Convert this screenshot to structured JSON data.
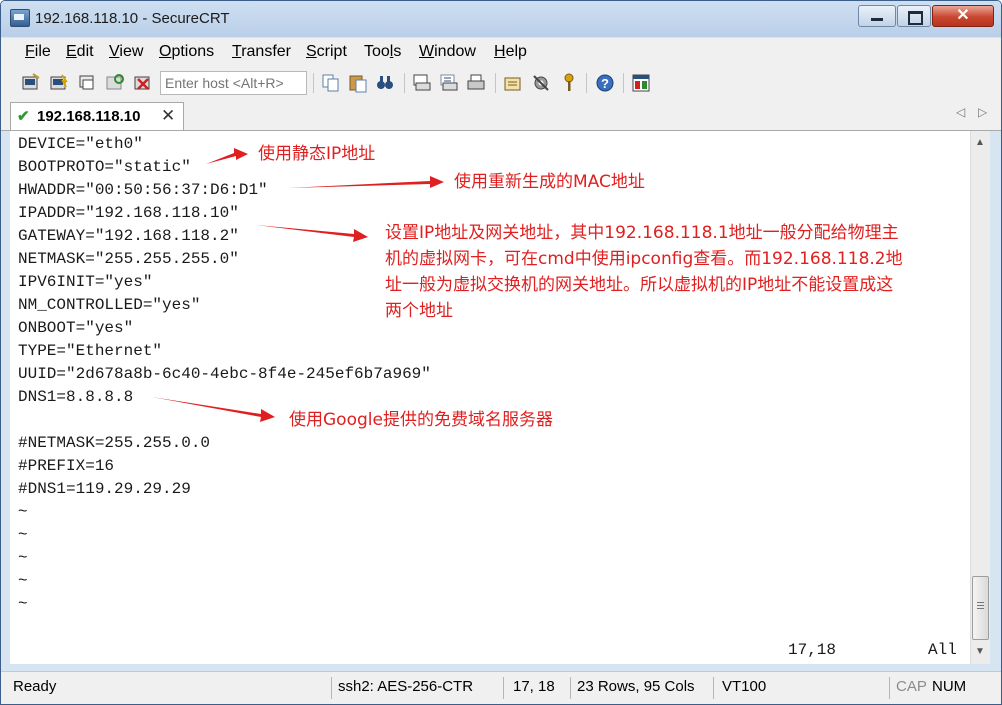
{
  "window": {
    "title": "192.168.118.10 - SecureCRT",
    "close_glyph": "✕"
  },
  "menu": [
    "File",
    "Edit",
    "View",
    "Options",
    "Transfer",
    "Script",
    "Tools",
    "Window",
    "Help"
  ],
  "menu_mnemonics": [
    "F",
    "E",
    "V",
    "O",
    "T",
    "S",
    "l",
    "W",
    "H"
  ],
  "toolbar": {
    "host_placeholder": "Enter host <Alt+R>"
  },
  "tab": {
    "label": "192.168.118.10",
    "check": "✔",
    "close": "✕"
  },
  "terminal": {
    "lines": [
      "DEVICE=\"eth0\"",
      "BOOTPROTO=\"static\"",
      "HWADDR=\"00:50:56:37:D6:D1\"",
      "IPADDR=\"192.168.118.10\"",
      "GATEWAY=\"192.168.118.2\"",
      "NETMASK=\"255.255.255.0\"",
      "IPV6INIT=\"yes\"",
      "NM_CONTROLLED=\"yes\"",
      "ONBOOT=\"yes\"",
      "TYPE=\"Ethernet\"",
      "UUID=\"2d678a8b-6c40-4ebc-8f4e-245ef6b7a969\"",
      "DNS1=8.8.8.8",
      "",
      "#NETMASK=255.255.0.0",
      "#PREFIX=16",
      "#DNS1=119.29.29.29",
      "~",
      "~",
      "~",
      "~",
      "~"
    ],
    "cursor_pos": "17,18",
    "view_pos": "All"
  },
  "annotations": {
    "static_ip": "使用静态IP地址",
    "mac": "使用重新生成的MAC地址",
    "gateway_lines": [
      "设置IP地址及网关地址，其中192.168.118.1地址一般分配给物理主",
      "机的虚拟网卡，可在cmd中使用ipconfig查看。而192.168.118.2地",
      "址一般为虚拟交换机的网关地址。所以虚拟机的IP地址不能设置成这",
      "两个地址"
    ],
    "dns": "使用Google提供的免费域名服务器"
  },
  "status": {
    "ready": "Ready",
    "cipher": "ssh2: AES-256-CTR",
    "position": "17,  18",
    "size": "23 Rows, 95 Cols",
    "term_type": "VT100",
    "cap": "CAP",
    "num": "NUM"
  },
  "colors": {
    "annotation": "#e02020",
    "accent": "#3b5f8a"
  }
}
